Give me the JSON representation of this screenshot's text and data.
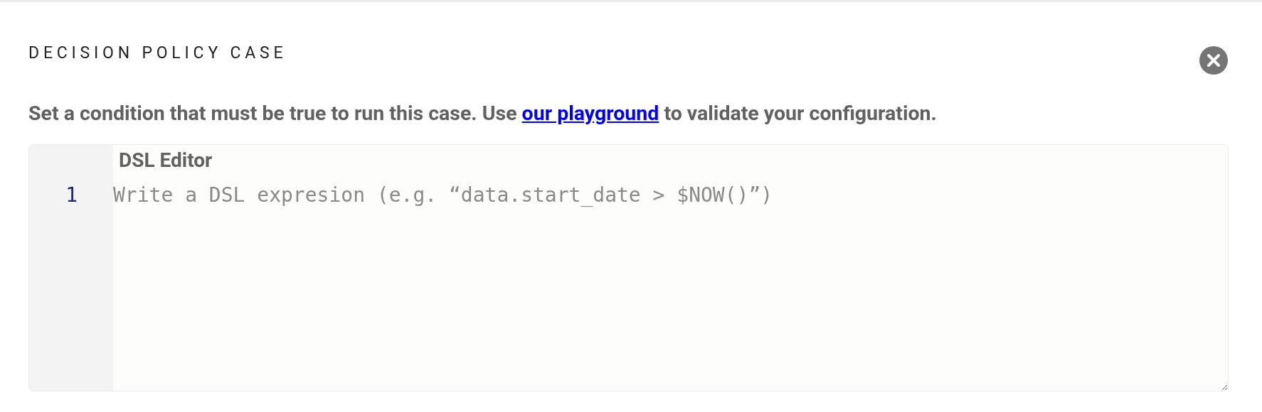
{
  "title": "DECISION POLICY CASE",
  "description": {
    "before": "Set a condition that must be true to run this case. Use ",
    "link": "our playground",
    "after": " to validate your configuration."
  },
  "editor": {
    "label": "DSL Editor",
    "line_numbers": [
      "1"
    ],
    "placeholder": "Write a DSL expresion (e.g. “data.start_date > $NOW()”)"
  }
}
